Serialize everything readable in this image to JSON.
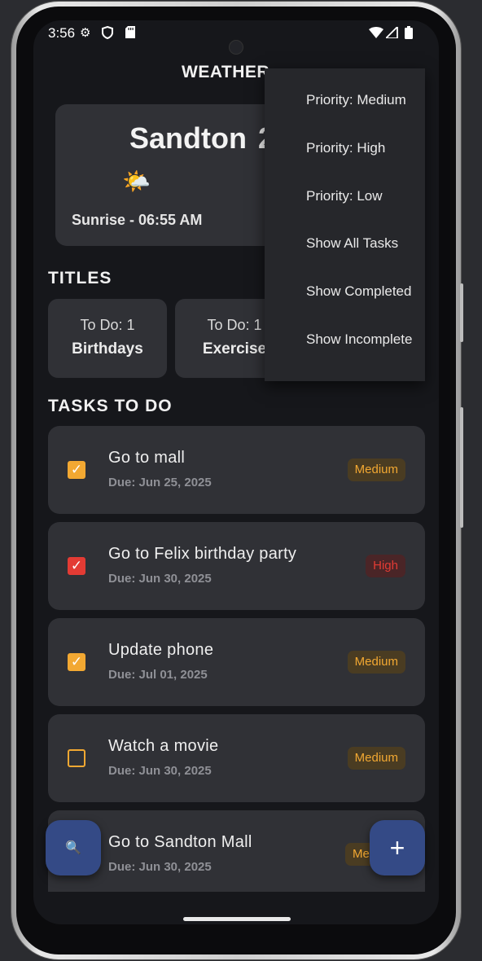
{
  "status_bar": {
    "time": "3:56",
    "icons": [
      "settings-icon",
      "shield-icon",
      "sd-card-icon",
      "wifi-icon",
      "signal-icon",
      "battery-icon"
    ]
  },
  "app": {
    "title": "WEATHER"
  },
  "weather": {
    "city": "Sandton",
    "temp_partial": "2",
    "condition_icon": "🌤️",
    "sunrise": "Sunrise - 06:55 AM"
  },
  "titles_section": {
    "heading": "TITLES",
    "cards": [
      {
        "count": "To Do: 1",
        "name": "Birthdays"
      },
      {
        "count": "To Do: 1",
        "name": "Exercise"
      }
    ]
  },
  "tasks_section": {
    "heading": "TASKS TO DO",
    "tasks": [
      {
        "title": "Go to mall",
        "due": "Due: Jun 25, 2025",
        "priority": "Medium",
        "checked": true
      },
      {
        "title": "Go to Felix birthday party",
        "due": "Due: Jun 30, 2025",
        "priority": "High",
        "checked": true
      },
      {
        "title": "Update phone",
        "due": "Due: Jul 01, 2025",
        "priority": "Medium",
        "checked": true
      },
      {
        "title": "Watch a movie",
        "due": "Due: Jun 30, 2025",
        "priority": "Medium",
        "checked": false
      },
      {
        "title": "Go to Sandton Mall",
        "due": "Due: Jun 30, 2025",
        "priority": "Me",
        "checked": false
      }
    ]
  },
  "menu": {
    "items": [
      "Priority: Medium",
      "Priority: High",
      "Priority: Low",
      "Show All Tasks",
      "Show Completed",
      "Show Incomplete"
    ]
  },
  "fabs": {
    "search_icon": "🔍",
    "add_icon": "+"
  },
  "colors": {
    "medium": "#f2a832",
    "high": "#e33b34",
    "fab": "#344a86",
    "card": "#303136",
    "background": "#16171b"
  }
}
